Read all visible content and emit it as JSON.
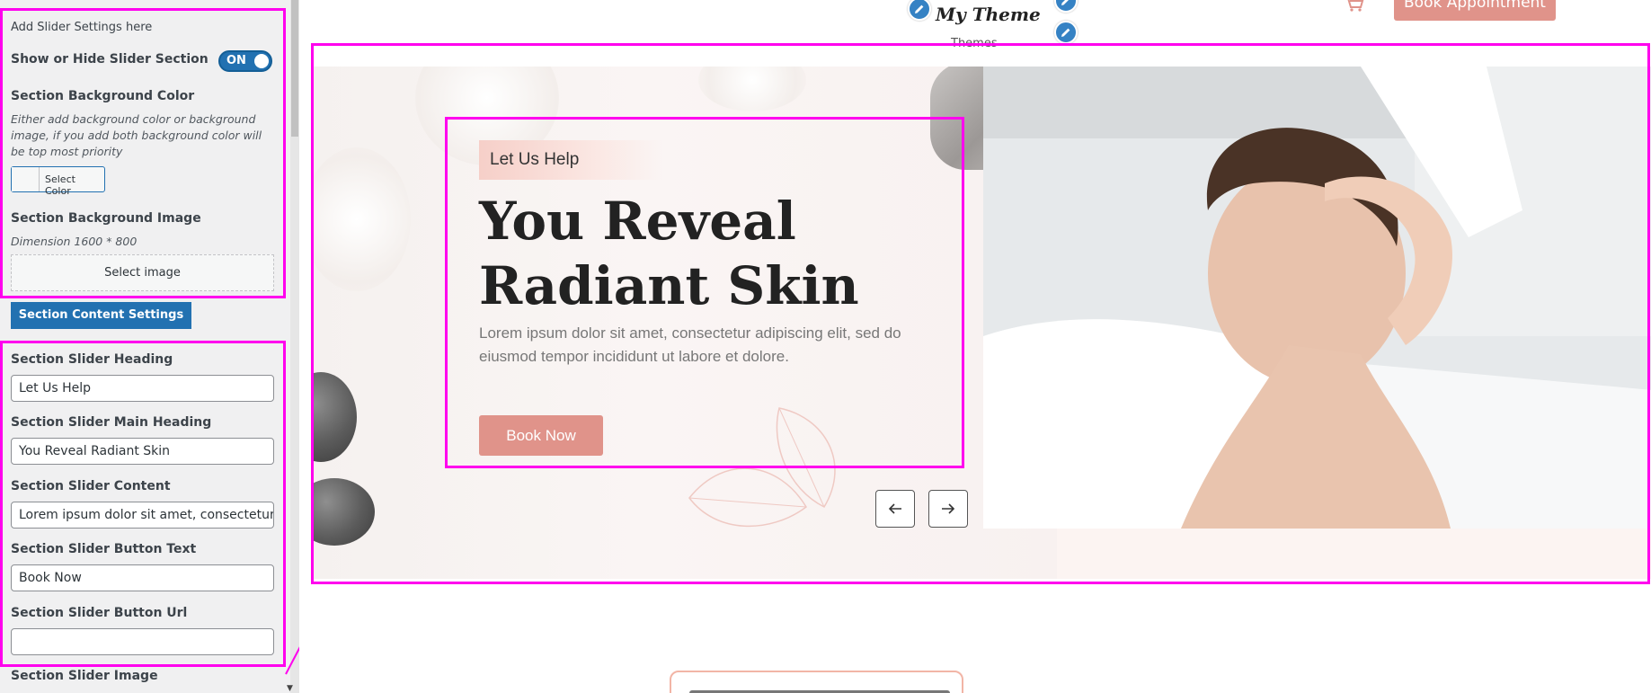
{
  "panel": {
    "intro": "Add Slider Settings here",
    "show_hide_label": "Show or Hide Slider Section",
    "toggle_state": "ON",
    "bg_color_label": "Section Background Color",
    "bg_color_desc": "Either add background color or background image, if you add both background color will be top most priority",
    "select_color_label": "Select Color",
    "bg_image_label": "Section Background Image",
    "bg_image_dimension": "Dimension 1600 * 800",
    "select_image_label": "Select image",
    "content_settings_button": "Section Content Settings",
    "fields": [
      {
        "label": "Section Slider Heading",
        "value": "Let Us Help"
      },
      {
        "label": "Section Slider Main Heading",
        "value": "You Reveal Radiant Skin"
      },
      {
        "label": "Section Slider Content",
        "value": "Lorem ipsum dolor sit amet, consectetur adipiscing elit, sed do"
      },
      {
        "label": "Section Slider Button Text",
        "value": "Book Now"
      },
      {
        "label": "Section Slider Button Url",
        "value": ""
      }
    ],
    "slider_image_label": "Section Slider Image"
  },
  "header": {
    "logo": "My Theme",
    "logo_sub": "Themes",
    "book_appointment": "Book Appointment"
  },
  "slide": {
    "tag": "Let Us Help",
    "main_heading": "You Reveal Radiant Skin",
    "content": "Lorem ipsum dolor sit amet, consectetur adipiscing elit, sed do eiusmod tempor incididunt ut labore et dolore.",
    "button": "Book Now"
  },
  "icons": {
    "edit": "pencil-icon",
    "cart": "cart-icon",
    "prev": "arrow-left-icon",
    "next": "arrow-right-icon"
  },
  "colors": {
    "accent": "#e0938a",
    "highlight": "#ff00ee",
    "wp_blue": "#2271b1"
  }
}
